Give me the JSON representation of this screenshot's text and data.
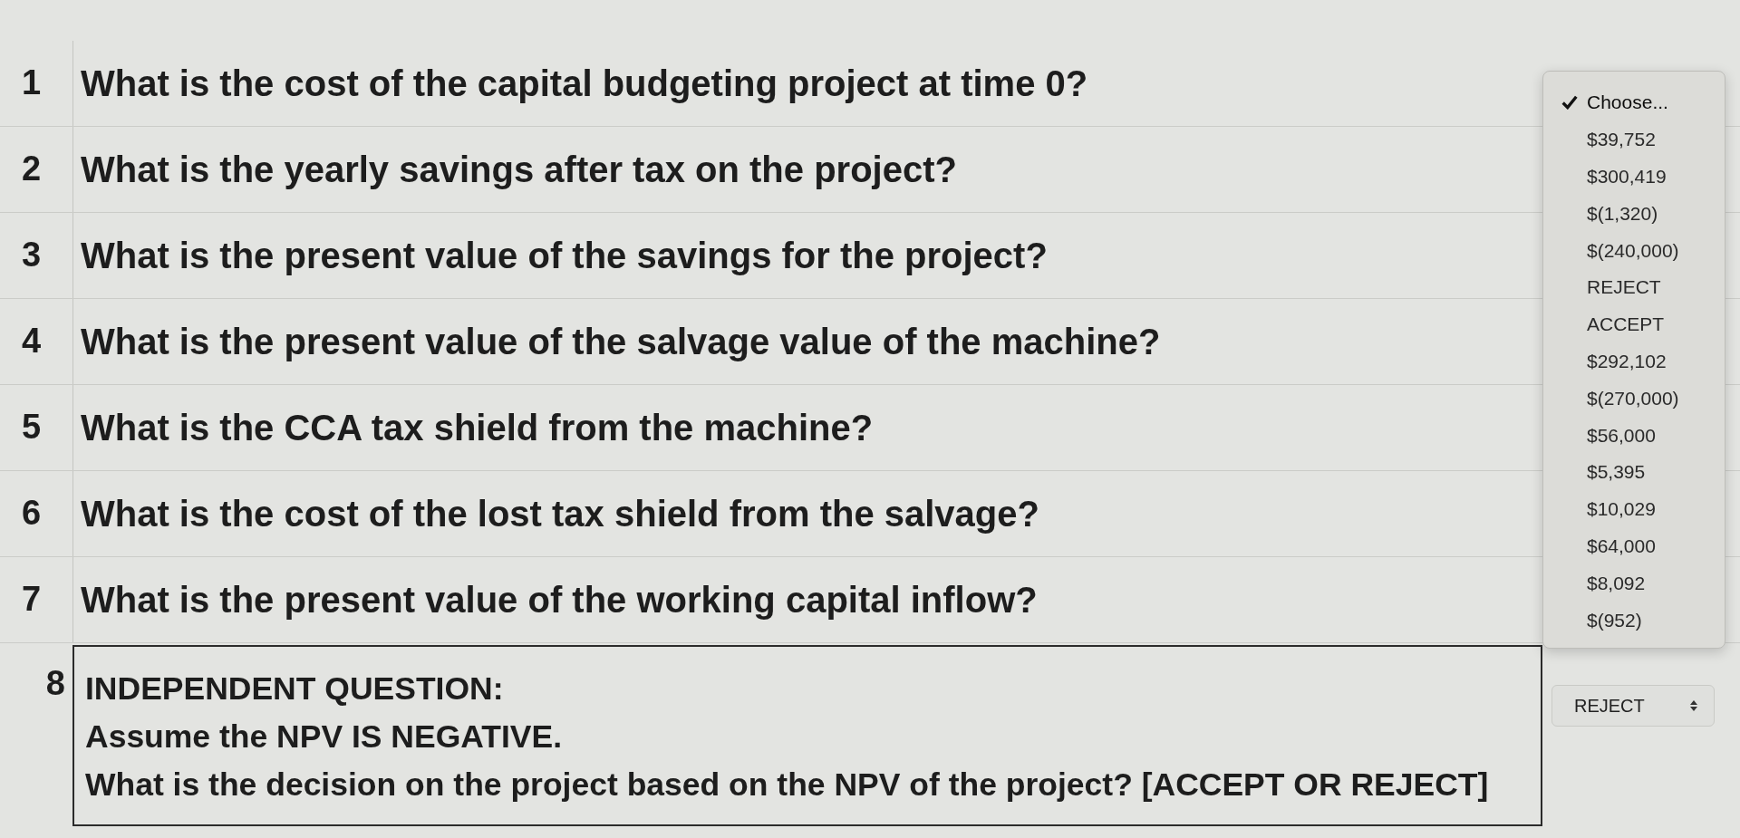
{
  "questions": [
    {
      "number": "1",
      "text": "What is the cost of the capital budgeting project at time 0?"
    },
    {
      "number": "2",
      "text": "What is the yearly savings after tax on the project?"
    },
    {
      "number": "3",
      "text": "What is the present value of the savings for the project?"
    },
    {
      "number": "4",
      "text": "What is the present value of the salvage value of the machine?"
    },
    {
      "number": "5",
      "text": "What is the CCA tax shield from the machine?"
    },
    {
      "number": "6",
      "text": "What is the cost of the lost tax shield from the salvage?"
    },
    {
      "number": "7",
      "text": "What is the present value of the working capital inflow?"
    }
  ],
  "dropdown": {
    "options": [
      {
        "label": "Choose...",
        "selected": true
      },
      {
        "label": "$39,752",
        "selected": false
      },
      {
        "label": "$300,419",
        "selected": false
      },
      {
        "label": "$(1,320)",
        "selected": false
      },
      {
        "label": "$(240,000)",
        "selected": false
      },
      {
        "label": "REJECT",
        "selected": false
      },
      {
        "label": "ACCEPT",
        "selected": false
      },
      {
        "label": "$292,102",
        "selected": false
      },
      {
        "label": "$(270,000)",
        "selected": false
      },
      {
        "label": "$56,000",
        "selected": false
      },
      {
        "label": "$5,395",
        "selected": false
      },
      {
        "label": "$10,029",
        "selected": false
      },
      {
        "label": "$64,000",
        "selected": false
      },
      {
        "label": "$8,092",
        "selected": false
      },
      {
        "label": "$(952)",
        "selected": false
      }
    ]
  },
  "independent_question": {
    "number": "8",
    "lines": [
      "INDEPENDENT QUESTION:",
      "Assume the NPV IS NEGATIVE.",
      "What is the decision on the project based on the NPV of the project? [ACCEPT OR REJECT]"
    ],
    "answer": {
      "value": "REJECT"
    }
  }
}
